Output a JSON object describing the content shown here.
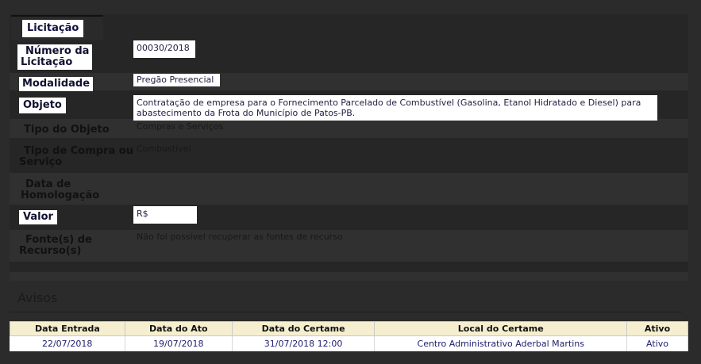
{
  "tab": {
    "label": "Licitação"
  },
  "fields": {
    "numero": {
      "label_line1": "Número da",
      "label_line2": "Licitação",
      "value": "00030/2018"
    },
    "modalidade": {
      "label": "Modalidade",
      "value": "Pregão Presencial"
    },
    "objeto": {
      "label": "Objeto",
      "value_line1": "Contratação de empresa para o Fornecimento Parcelado de Combustível (Gasolina, Etanol Hidratado e Diesel) para",
      "value_line2": "abastecimento da Frota do Município de Patos-PB."
    },
    "tipo_objeto": {
      "label": "Tipo do Objeto",
      "value": "Compras e Serviços"
    },
    "tipo_compra": {
      "label_line1": "Tipo de Compra ou",
      "label_line2": "Serviço",
      "value": "Combustível"
    },
    "data_homologacao": {
      "label_line1": "Data de",
      "label_line2": "Homologação",
      "value": ""
    },
    "valor": {
      "label": "Valor",
      "value": "R$"
    },
    "fontes": {
      "label_line1": "Fonte(s) de",
      "label_line2": "Recurso(s)",
      "value": "Não foi possível recuperar as fontes de recurso"
    }
  },
  "avisos": {
    "title": "Avisos",
    "columns": [
      "Data Entrada",
      "Data do Ato",
      "Data do Certame",
      "Local do Certame",
      "Ativo"
    ],
    "rows": [
      [
        "22/07/2018",
        "19/07/2018",
        "31/07/2018 12:00",
        "Centro Administrativo Aderbal Martins",
        "Ativo"
      ]
    ]
  },
  "colors": {
    "background": "#2b2b2b",
    "highlight": "#ffffff",
    "header": "#f6efcf",
    "text_link": "#202070"
  }
}
